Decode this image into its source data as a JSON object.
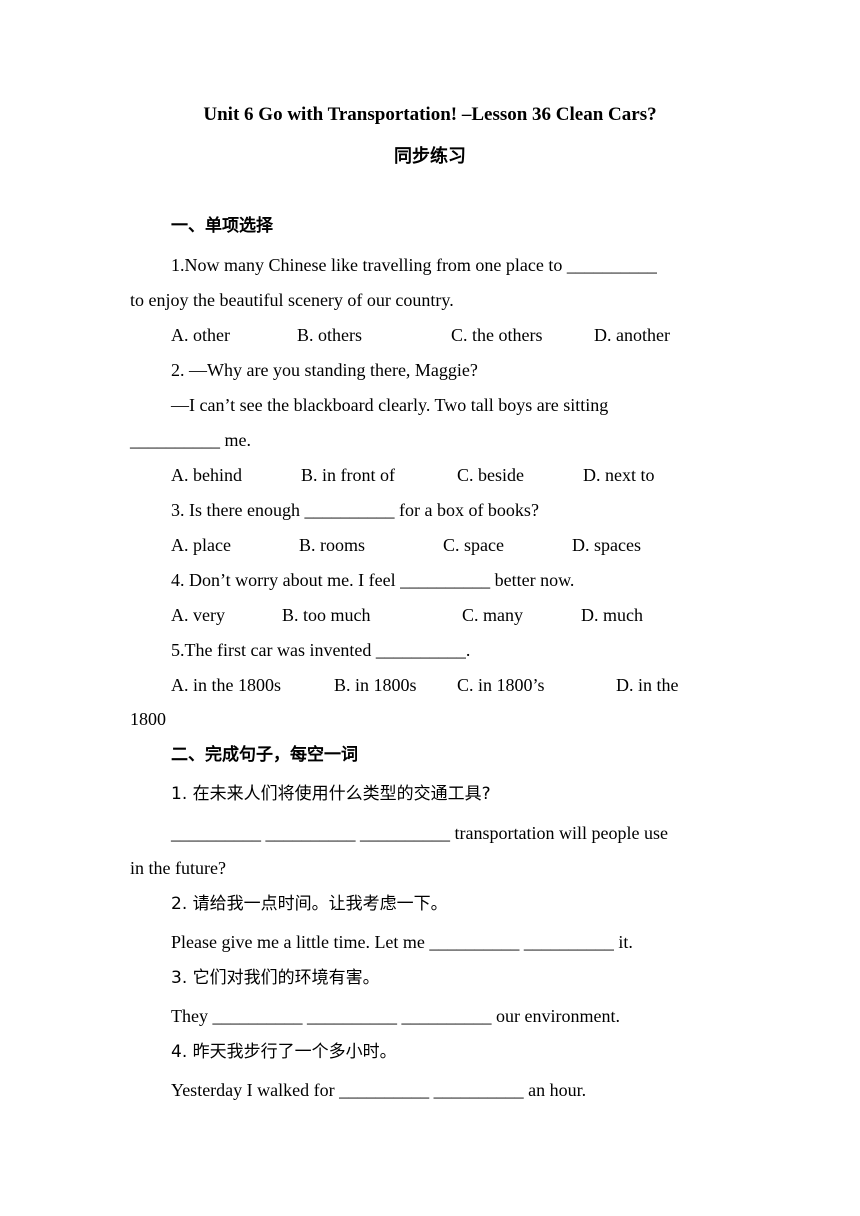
{
  "title": "Unit 6 Go with Transportation! –Lesson 36 Clean Cars?",
  "subtitle": "同步练习",
  "section1": {
    "heading": "一、单项选择",
    "questions": [
      {
        "line1": "1.Now many Chinese like travelling from one place to __________",
        "line2": "to enjoy the beautiful scenery of our country.",
        "options": [
          "A. other",
          "B. others",
          "C. the others",
          "D. another"
        ]
      },
      {
        "line1": "2. —Why are you standing there, Maggie?",
        "line2": "—I can’t see the blackboard clearly. Two tall boys are sitting",
        "line3": "__________ me.",
        "options": [
          "A. behind",
          "B. in front of",
          "C. beside",
          "D. next to"
        ]
      },
      {
        "line1": "3. Is there enough __________ for a box of books?",
        "options": [
          "A. place",
          "B. rooms",
          "C. space",
          "D. spaces"
        ]
      },
      {
        "line1": "4. Don’t worry about me. I feel __________ better now.",
        "options": [
          "A. very",
          "B. too much",
          "C. many",
          "D. much"
        ]
      },
      {
        "line1": "5.The first car was invented __________.",
        "options": [
          "A. in the 1800s",
          "B. in 1800s",
          "C. in 1800’s",
          "D. in the"
        ],
        "wrap": "1800"
      }
    ]
  },
  "section2": {
    "heading": "二、完成句子，每空一词",
    "items": [
      {
        "chinese": "1.  在未来人们将使用什么类型的交通工具?",
        "english": "__________ __________ __________ transportation will people use",
        "english_wrap": "in the future?"
      },
      {
        "chinese": "2.  请给我一点时间。让我考虑一下。",
        "english": "Please give me a little time. Let me __________ __________ it."
      },
      {
        "chinese": "3.  它们对我们的环境有害。",
        "english": "They __________ __________ __________ our environment."
      },
      {
        "chinese": "4.  昨天我步行了一个多小时。",
        "english": "Yesterday I walked for __________ __________ an hour."
      }
    ]
  }
}
